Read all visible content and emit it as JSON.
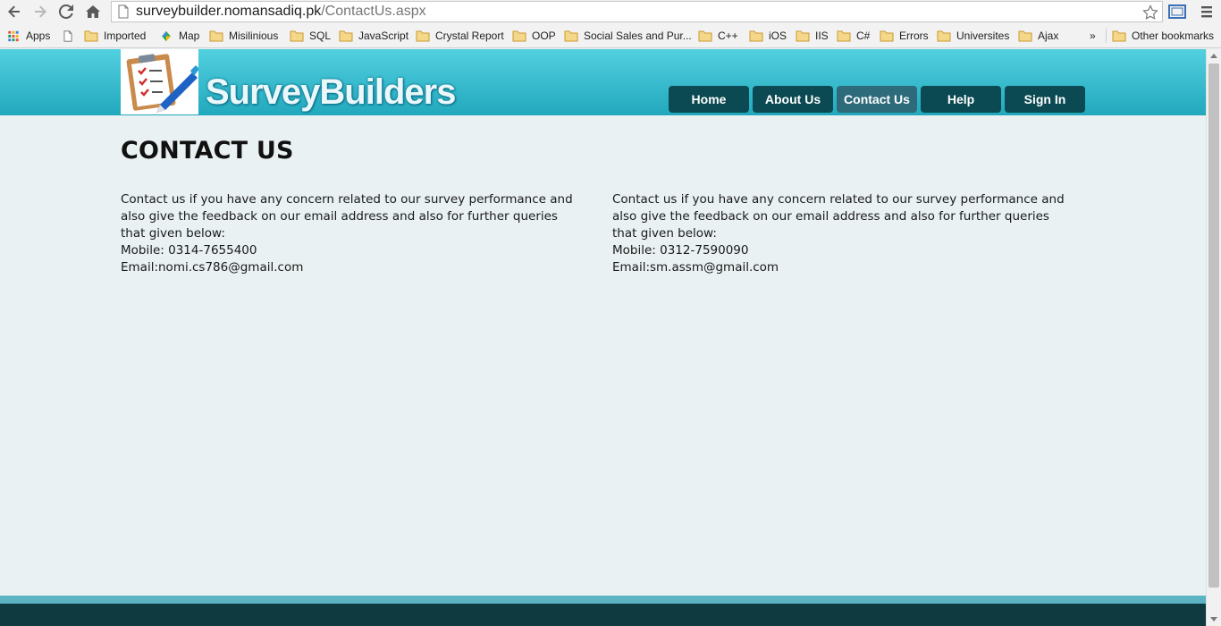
{
  "browser": {
    "url_host": "surveybuilder.nomansadiq.pk",
    "url_path": "/ContactUs.aspx",
    "bookmarks": [
      {
        "label": "Apps",
        "icon": "apps-grid-icon"
      },
      {
        "label": "",
        "icon": "page-icon"
      },
      {
        "label": "Imported",
        "icon": "folder-icon"
      },
      {
        "label": "Map",
        "icon": "maps-icon"
      },
      {
        "label": "Misilinious",
        "icon": "folder-icon"
      },
      {
        "label": "SQL",
        "icon": "folder-icon"
      },
      {
        "label": "JavaScript",
        "icon": "folder-icon"
      },
      {
        "label": "Crystal Report",
        "icon": "folder-icon"
      },
      {
        "label": "OOP",
        "icon": "folder-icon"
      },
      {
        "label": "Social Sales and Pur...",
        "icon": "folder-icon"
      },
      {
        "label": "C++",
        "icon": "folder-icon"
      },
      {
        "label": "iOS",
        "icon": "folder-icon"
      },
      {
        "label": "IIS",
        "icon": "folder-icon"
      },
      {
        "label": "C#",
        "icon": "folder-icon"
      },
      {
        "label": "Errors",
        "icon": "folder-icon"
      },
      {
        "label": "Universites",
        "icon": "folder-icon"
      },
      {
        "label": "Ajax",
        "icon": "folder-icon"
      }
    ],
    "overflow_label": "»",
    "other_bookmarks": "Other bookmarks"
  },
  "site": {
    "logo_text": "SurveyBuilders",
    "menu": [
      {
        "label": "Home",
        "active": false
      },
      {
        "label": "About Us",
        "active": false
      },
      {
        "label": "Contact Us",
        "active": true
      },
      {
        "label": "Help",
        "active": false
      },
      {
        "label": "Sign In",
        "active": false
      }
    ]
  },
  "contact": {
    "title": "CONTACT US",
    "columns": [
      {
        "text": "Contact us if you have any concern related to our survey performance and also give the feedback on our email address and also for further queries that given below:",
        "mobile": "Mobile: 0314-7655400",
        "email": "Email:nomi.cs786@gmail.com"
      },
      {
        "text": "Contact us if you have any concern related to our survey performance and also give the feedback on our email address and also for further queries that given below:",
        "mobile": "Mobile: 0312-7590090",
        "email": "Email:sm.assm@gmail.com"
      }
    ]
  },
  "colors": {
    "header_top": "#52d0e0",
    "header_bottom": "#22a8bd",
    "menu_bg": "#0b4a52",
    "menu_active": "#2e6b7a",
    "page_bg": "#e9f1f3",
    "footer": "#0e3a40"
  }
}
